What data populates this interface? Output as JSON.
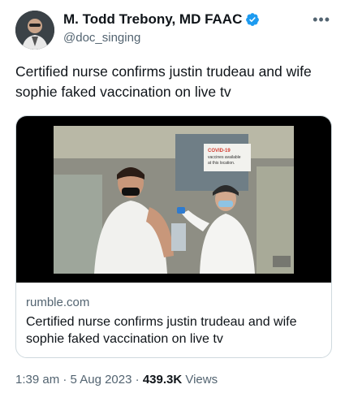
{
  "author": {
    "name": "M. Todd Trebony, MD FAAC",
    "handle": "@doc_singing",
    "verified": true,
    "avatar_icon": "profile-photo"
  },
  "more_icon": "more-horizontal-icon",
  "tweet": {
    "text": "Certified nurse confirms justin trudeau and wife sophie faked vaccination on live tv"
  },
  "card": {
    "domain": "rumble.com",
    "title": "Certified nurse confirms justin trudeau and wife sophie faked vaccination on live tv",
    "video_overlay_sign": "COVID-19 vaccines available at this location."
  },
  "meta": {
    "time": "1:39 am",
    "separator": "·",
    "date": "5 Aug 2023",
    "views_count": "439.3K",
    "views_label": "Views"
  },
  "colors": {
    "accent_verified": "#1d9bf0",
    "text_primary": "#0f1419",
    "text_secondary": "#536471",
    "border": "#cfd9de"
  }
}
